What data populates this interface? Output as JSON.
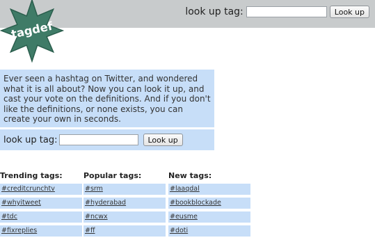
{
  "header": {
    "search_label": "look up tag:",
    "search_value": "",
    "button_label": "Look up"
  },
  "logo": {
    "text": "tagdef"
  },
  "intro": {
    "text": "Ever seen a hashtag on Twitter, and wondered what it is all about? Now you can look it up, and cast your vote on the definitions. And if you don't like the definitions, or none exists, you can create your own in seconds.",
    "search_label": "look up tag:",
    "search_value": "",
    "button_label": "Look up"
  },
  "colors": {
    "topbar": "#c8cbcc",
    "panel": "#c7def8",
    "logo_star": "#3f7b67",
    "logo_text": "#ffffff"
  },
  "lists": [
    {
      "title": "Trending tags:",
      "items": [
        "#creditcrunchtv",
        "#whyitweet",
        "#tdc",
        "#fixreplies"
      ]
    },
    {
      "title": "Popular tags:",
      "items": [
        "#srm",
        "#hyderabad",
        "#ncwx",
        "#ff"
      ]
    },
    {
      "title": "New tags:",
      "items": [
        "#laaqdal",
        "#bookblockade",
        "#eusme",
        "#doti"
      ]
    }
  ]
}
